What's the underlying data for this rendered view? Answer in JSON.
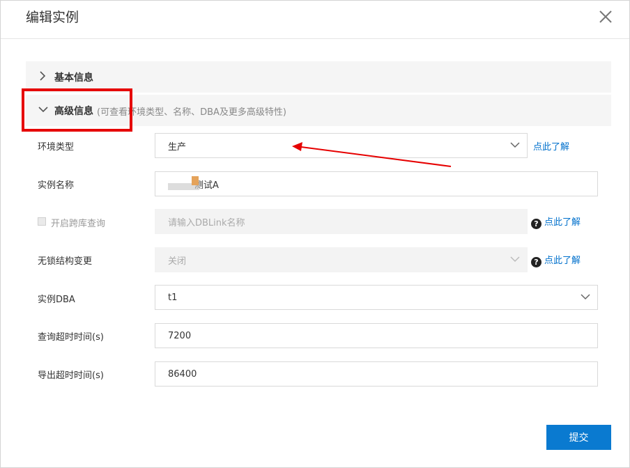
{
  "dialog": {
    "title": "编辑实例"
  },
  "sections": {
    "basic": {
      "title": "基本信息"
    },
    "advanced": {
      "title": "高级信息",
      "hint": "(可查看环境类型、名称、DBA及更多高级特性)"
    }
  },
  "form": {
    "env_type": {
      "label": "环境类型",
      "value": "生产",
      "help": "点此了解"
    },
    "instance_name": {
      "label": "实例名称",
      "value": "测试A"
    },
    "cross_db": {
      "label": "开启跨库查询",
      "placeholder": "请输入DBLink名称",
      "help": "点此了解"
    },
    "lockless": {
      "label": "无锁结构变更",
      "value": "关闭",
      "help": "点此了解"
    },
    "dba": {
      "label": "实例DBA",
      "value": "t1"
    },
    "query_timeout": {
      "label": "查询超时时间(s)",
      "value": "7200"
    },
    "export_timeout": {
      "label": "导出超时时间(s)",
      "value": "86400"
    }
  },
  "actions": {
    "submit": "提交"
  },
  "annotation_colors": {
    "highlight": "#e60000",
    "arrow": "#e60000"
  },
  "accent_color": "#0a7ad0"
}
